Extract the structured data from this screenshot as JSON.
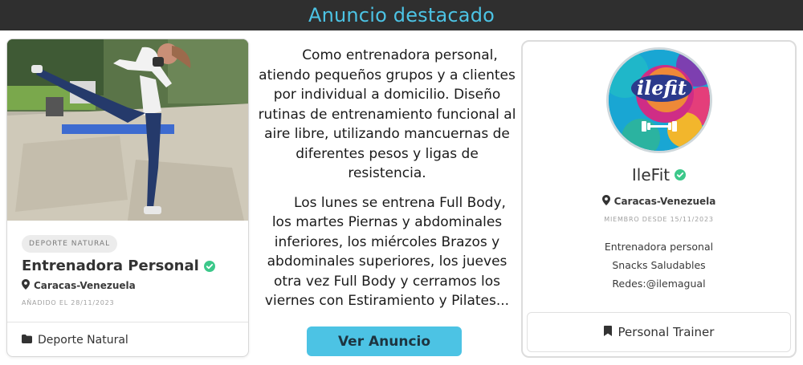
{
  "header": {
    "title": "Anuncio destacado"
  },
  "left_card": {
    "category": "DEPORTE NATURAL",
    "title": "Entrenadora Personal",
    "location": "Caracas-Venezuela",
    "added_date": "AÑADIDO EL 28/11/2023",
    "footer_category": "Deporte Natural",
    "icons": {
      "verified": "verified-check-icon",
      "location": "map-pin-icon",
      "folder": "folder-icon"
    }
  },
  "description": {
    "paragraph_1": "Como entrenadora personal, atiendo pequeños grupos y a clientes por individual a domicilio. Diseño rutinas de entrenamiento funcional al aire libre, utilizando mancuernas de diferentes pesos y ligas de resistencia.",
    "paragraph_2": "Los lunes se entrena Full Body, los martes Piernas y abdominales inferiores, los miércoles Brazos y abdominales superiores, los jueves otra vez Full Body y cerramos los viernes con Estiramiento y Pilates..."
  },
  "cta": {
    "label": "Ver Anuncio"
  },
  "right_card": {
    "logo_text": "ilefit",
    "name": "IleFit",
    "location": "Caracas-Venezuela",
    "member_since": "MIEMBRO DESDE 15/11/2023",
    "info_lines": [
      "Entrenadora personal",
      "Snacks Saludables",
      "Redes:@ilemagual"
    ],
    "footer_label": "Personal Trainer",
    "icons": {
      "verified": "verified-check-icon",
      "location": "map-pin-icon",
      "bookmark": "bookmark-icon"
    }
  },
  "colors": {
    "accent": "#4cc3e4",
    "header_bg": "#2f2f2f",
    "verified": "#3cc88a"
  }
}
